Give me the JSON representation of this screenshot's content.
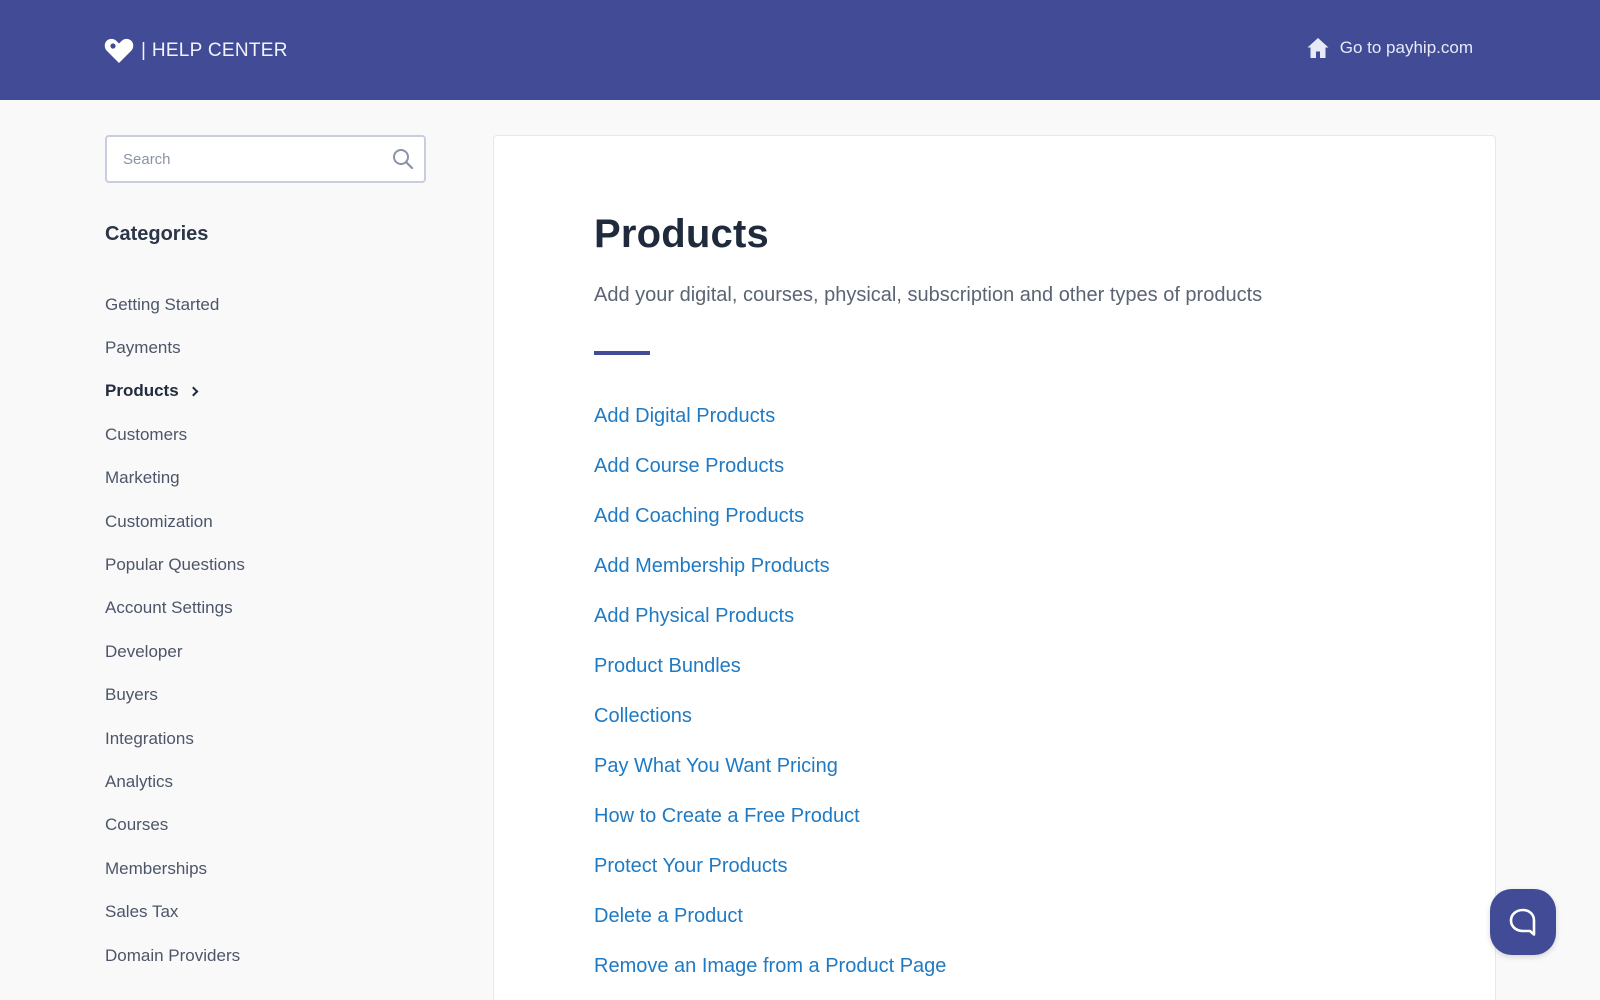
{
  "header": {
    "logo_text": "| HELP CENTER",
    "home_link_label": "Go to payhip.com",
    "background_color": "#414b96"
  },
  "sidebar": {
    "search": {
      "placeholder": "Search",
      "value": ""
    },
    "categories_heading": "Categories",
    "categories": [
      {
        "label": "Getting Started",
        "active": false
      },
      {
        "label": "Payments",
        "active": false
      },
      {
        "label": "Products",
        "active": true
      },
      {
        "label": "Customers",
        "active": false
      },
      {
        "label": "Marketing",
        "active": false
      },
      {
        "label": "Customization",
        "active": false
      },
      {
        "label": "Popular Questions",
        "active": false
      },
      {
        "label": "Account Settings",
        "active": false
      },
      {
        "label": "Developer",
        "active": false
      },
      {
        "label": "Buyers",
        "active": false
      },
      {
        "label": "Integrations",
        "active": false
      },
      {
        "label": "Analytics",
        "active": false
      },
      {
        "label": "Courses",
        "active": false
      },
      {
        "label": "Memberships",
        "active": false
      },
      {
        "label": "Sales Tax",
        "active": false
      },
      {
        "label": "Domain Providers",
        "active": false
      }
    ]
  },
  "main": {
    "title": "Products",
    "description": "Add your digital, courses, physical, subscription and other types of products",
    "articles": [
      "Add Digital Products",
      "Add Course Products",
      "Add Coaching Products",
      "Add Membership Products",
      "Add Physical Products",
      "Product Bundles",
      "Collections",
      "Pay What You Want Pricing",
      "How to Create a Free Product",
      "Protect Your Products",
      "Delete a Product",
      "Remove an Image from a Product Page"
    ],
    "link_color": "#1f7ac4",
    "accent_color": "#414b96"
  },
  "icons": {
    "logo": "heart-tag-icon",
    "home": "home-icon",
    "search": "search-icon",
    "chevron": "chevron-right-icon",
    "beacon": "chat-bubble-icon"
  }
}
